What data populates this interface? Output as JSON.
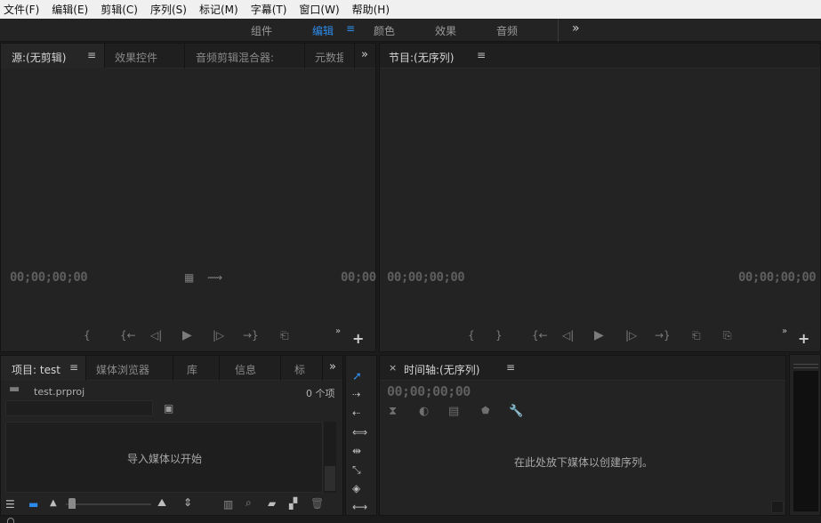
{
  "menubar": {
    "items": [
      "文件(F)",
      "编辑(E)",
      "剪辑(C)",
      "序列(S)",
      "标记(M)",
      "字幕(T)",
      "窗口(W)",
      "帮助(H)"
    ]
  },
  "workspaces": {
    "items": [
      "组件",
      "编辑",
      "颜色",
      "效果",
      "音频"
    ],
    "active": "编辑",
    "menu_glyph": "≡",
    "more_glyph": "»"
  },
  "source_panel": {
    "tabs": [
      "源:(无剪辑)",
      "效果控件",
      "音频剪辑混合器:",
      "元数据"
    ],
    "tab_menu": "≡",
    "more_glyph": "»",
    "timecode_left": "00;00;00;00",
    "timecode_right": "00;00",
    "controls": [
      "{",
      "{←",
      "◁|",
      "▶",
      "|▷",
      "→}",
      "⎗"
    ],
    "add": "+"
  },
  "program_panel": {
    "title": "节目:(无序列)",
    "tab_menu": "≡",
    "timecode_left": "00;00;00;00",
    "timecode_right": "00;00;00;00",
    "controls": [
      "{",
      "}",
      "{←",
      "◁|",
      "▶",
      "|▷",
      "→}",
      "⎗",
      "⎘"
    ],
    "more_glyph": "»",
    "add": "+"
  },
  "project_panel": {
    "tabs": [
      "项目: test",
      "媒体浏览器",
      "库",
      "信息",
      "标"
    ],
    "tab_menu": "≡",
    "more_glyph": "»",
    "file_name": "test.prproj",
    "item_count": "0 个项",
    "drop_hint": "导入媒体以开始"
  },
  "tools_panel": {
    "tools": [
      "selection-tool",
      "track-select-forward-tool",
      "track-select-backward-tool",
      "ripple-edit-tool",
      "rolling-edit-tool",
      "rate-stretch-tool",
      "razor-tool",
      "slip-tool"
    ]
  },
  "timeline_panel": {
    "close": "×",
    "title": "时间轴:(无序列)",
    "tab_menu": "≡",
    "timecode": "00;00;00;00",
    "drop_hint": "在此处放下媒体以创建序列。"
  },
  "colors": {
    "accent": "#2d8ceb",
    "panel_bg": "#232323",
    "menubar_bg": "#f0f0f0"
  }
}
